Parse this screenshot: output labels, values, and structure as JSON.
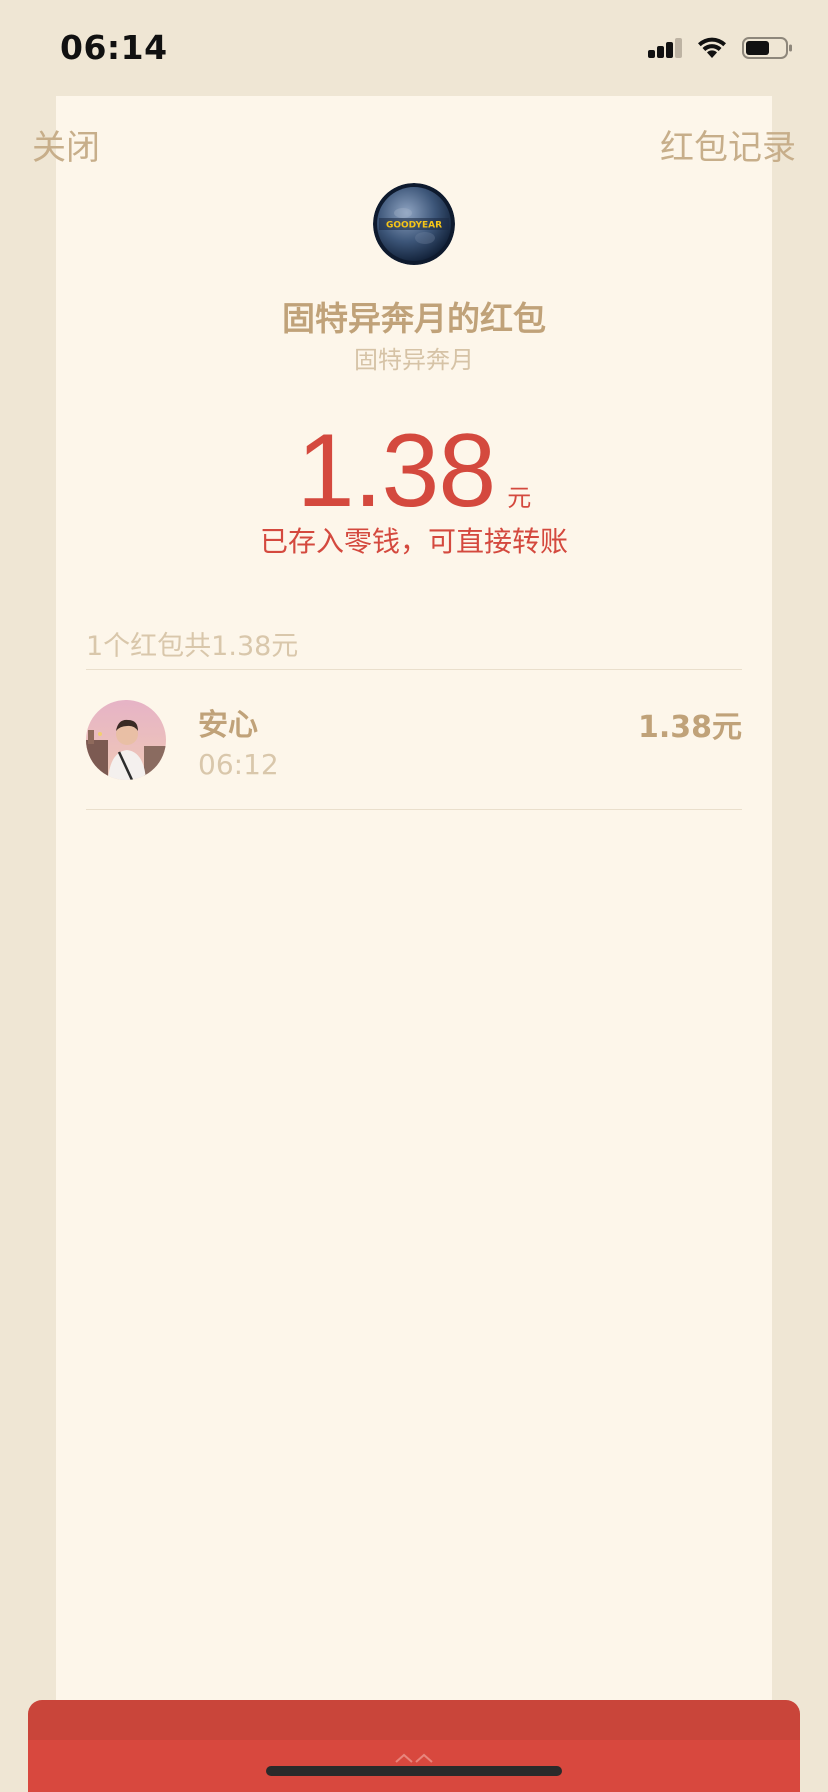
{
  "status_bar": {
    "time": "06:14"
  },
  "header": {
    "close_label": "关闭",
    "records_label": "红包记录"
  },
  "sender": {
    "logo_text": "GOODYEAR",
    "title": "固特异奔月的红包",
    "subtitle": "固特异奔月"
  },
  "amount": {
    "value": "1.38",
    "unit": "元",
    "note": "已存入零钱，可直接转账"
  },
  "summary": "1个红包共1.38元",
  "receivers": [
    {
      "name": "安心",
      "time": "06:12",
      "amount": "1.38元"
    }
  ],
  "colors": {
    "accent_red": "#d4493e",
    "gold_text": "#c0a279",
    "sheet_bg": "#fdf6ea",
    "page_bg": "#efe6d4"
  },
  "icons": {
    "signal": "cellular-signal-icon",
    "wifi": "wifi-icon",
    "battery": "battery-icon"
  }
}
